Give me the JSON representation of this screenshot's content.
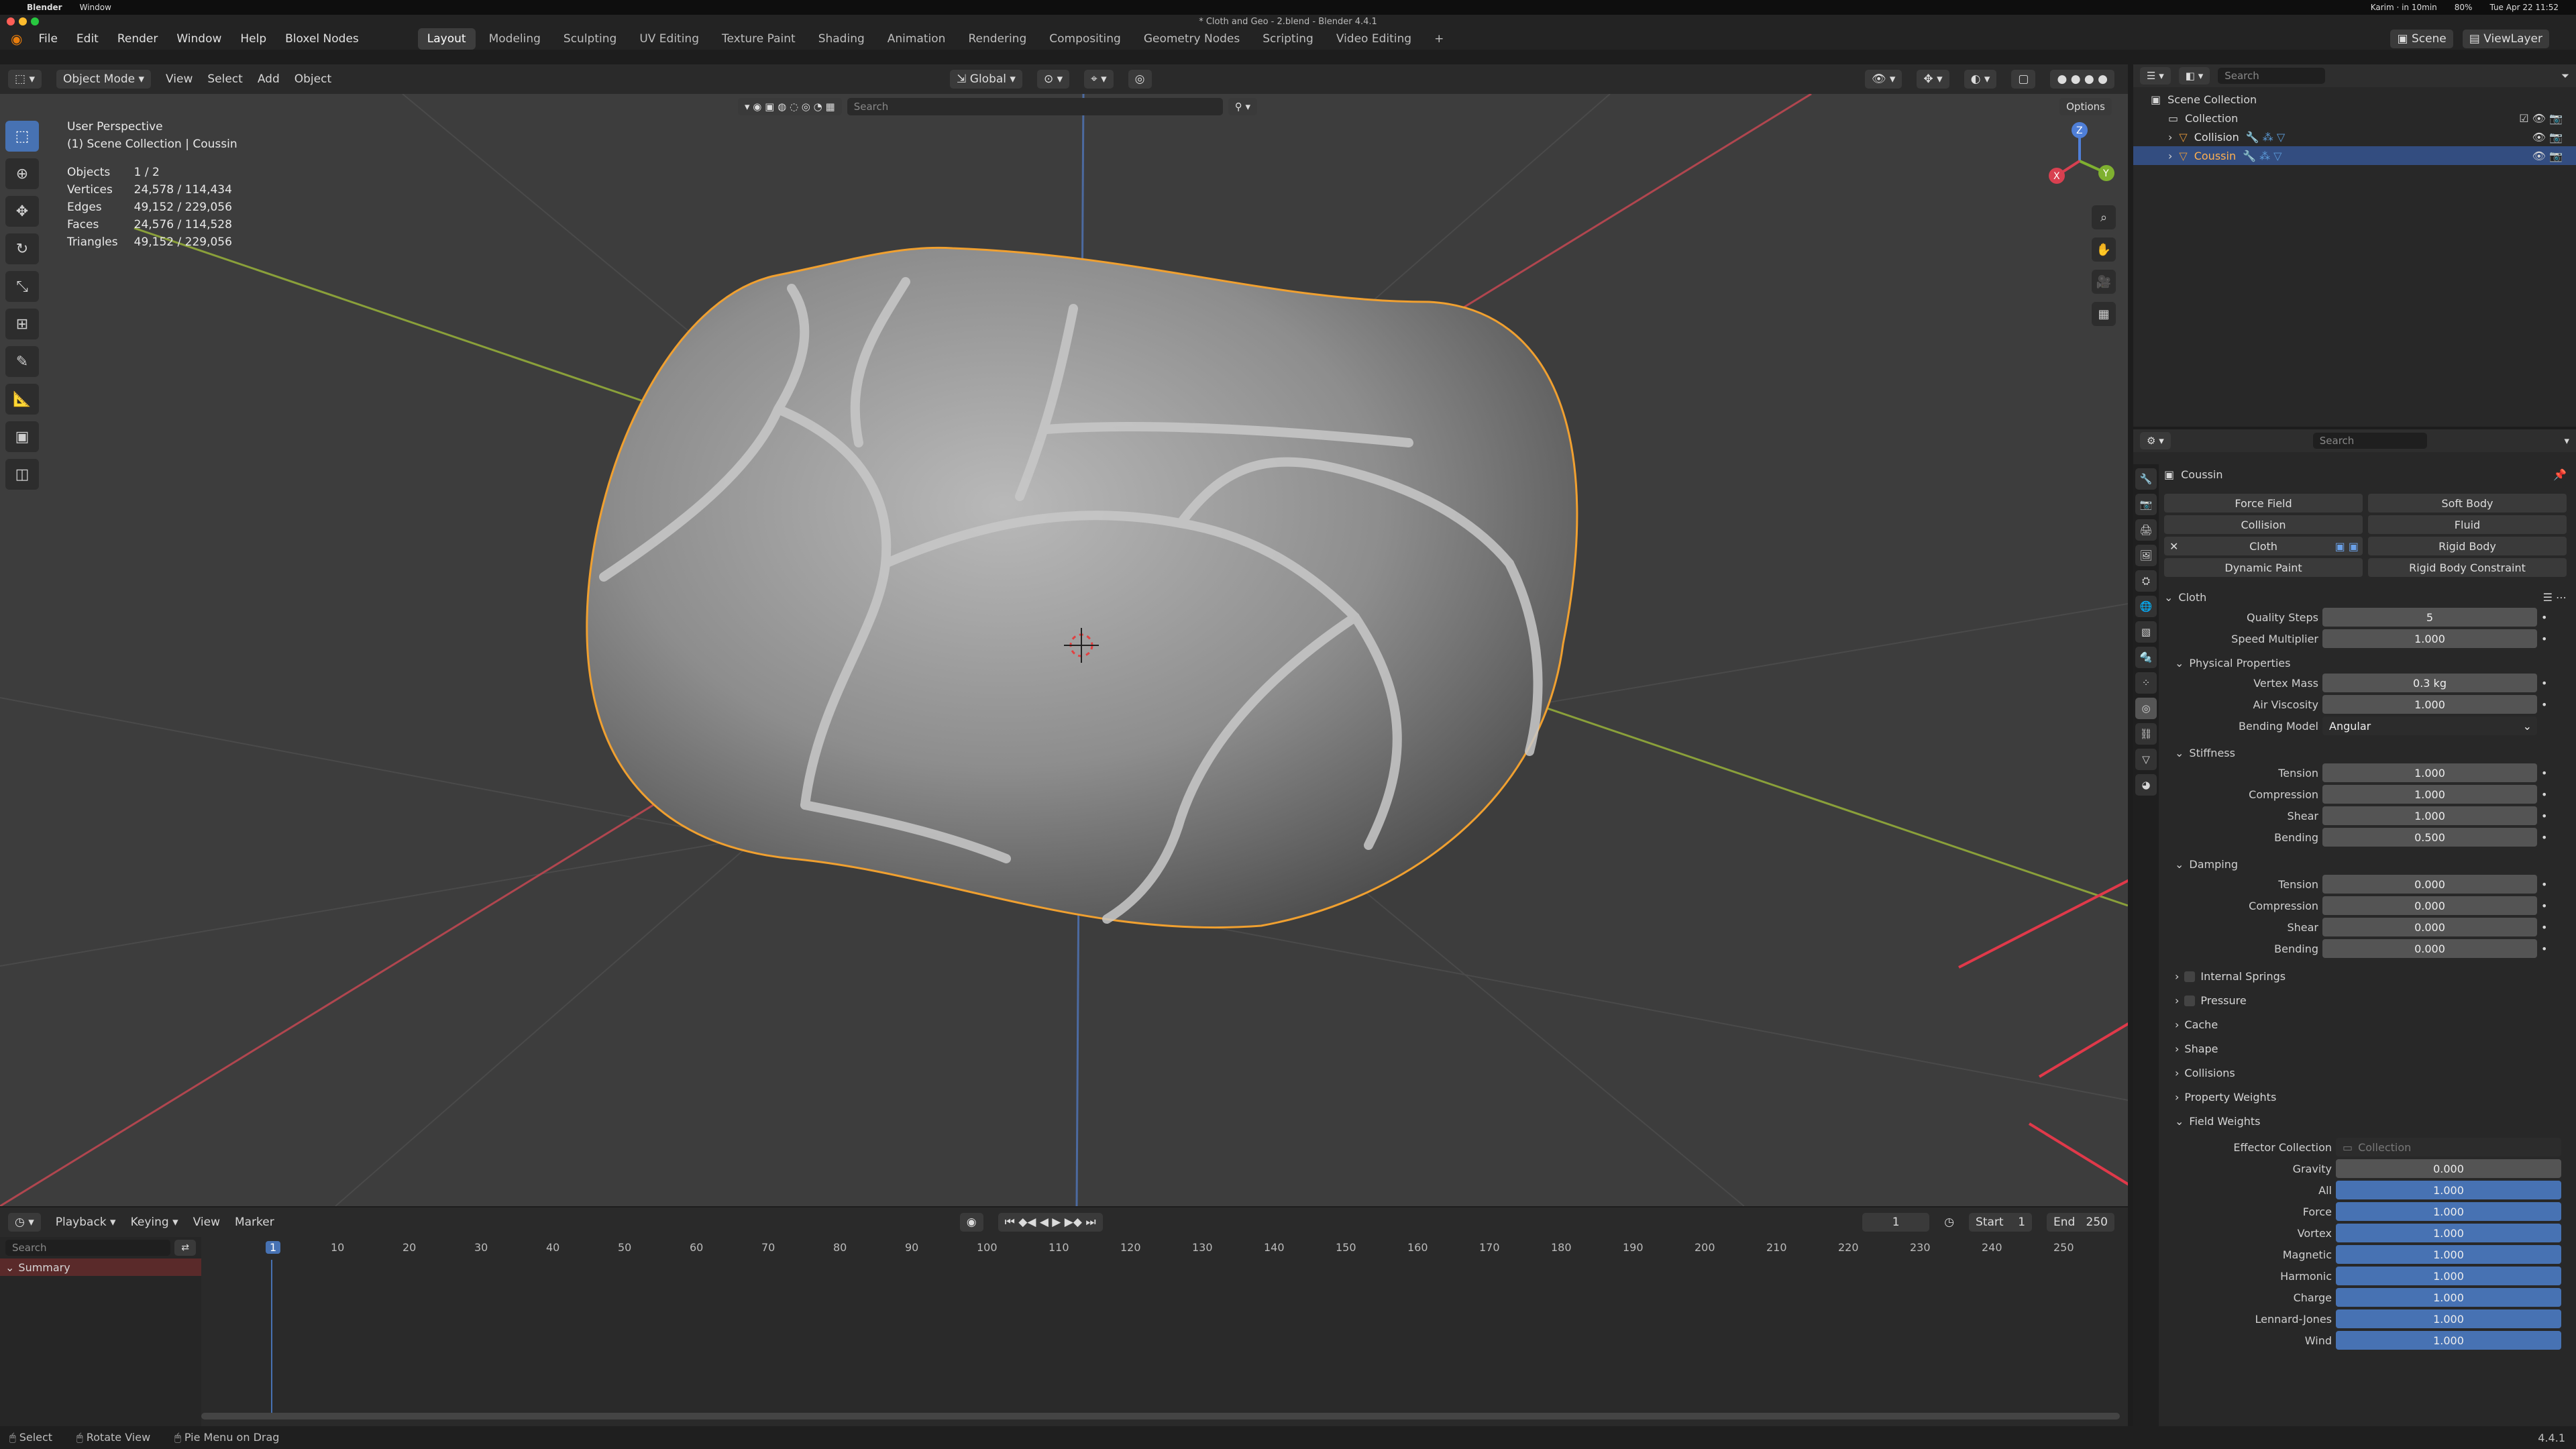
{
  "mac": {
    "apple": "",
    "app": "Blender",
    "window_menu": "Window",
    "meeting": "Karim · in 10min",
    "clock": "Tue Apr 22  11:52",
    "battery": "80%"
  },
  "titlebar": {
    "title": "* Cloth and Geo - 2.blend - Blender 4.4.1"
  },
  "menus": [
    "File",
    "Edit",
    "Render",
    "Window",
    "Help",
    "Bloxel Nodes"
  ],
  "workspaces": [
    "Layout",
    "Modeling",
    "Sculpting",
    "UV Editing",
    "Texture Paint",
    "Shading",
    "Animation",
    "Rendering",
    "Compositing",
    "Geometry Nodes",
    "Scripting",
    "Video Editing"
  ],
  "active_workspace": "Layout",
  "scene": {
    "label": "Scene",
    "viewlayer": "ViewLayer"
  },
  "viewport_header": {
    "mode": "Object Mode",
    "menus": [
      "View",
      "Select",
      "Add",
      "Object"
    ],
    "orientation": "Global",
    "search_placeholder": "Search",
    "options": "Options"
  },
  "viewport_info": {
    "perspective": "User Perspective",
    "collection": "(1) Scene Collection | Coussin",
    "stats": [
      {
        "label": "Objects",
        "value": "1 / 2"
      },
      {
        "label": "Vertices",
        "value": "24,578 / 114,434"
      },
      {
        "label": "Edges",
        "value": "49,152 / 229,056"
      },
      {
        "label": "Faces",
        "value": "24,576 / 114,528"
      },
      {
        "label": "Triangles",
        "value": "49,152 / 229,056"
      }
    ]
  },
  "gizmo_axes": {
    "x": "X",
    "y": "Y",
    "z": "Z"
  },
  "outliner": {
    "search_placeholder": "Search",
    "root": "Scene Collection",
    "collection": "Collection",
    "items": [
      "Collision",
      "Coussin"
    ],
    "selected": "Coussin"
  },
  "properties": {
    "search_placeholder": "Search",
    "object_name": "Coussin",
    "physics_buttons": [
      [
        "Force Field",
        "Soft Body"
      ],
      [
        "Collision",
        "Fluid"
      ],
      [
        "Cloth",
        "Rigid Body"
      ],
      [
        "Dynamic Paint",
        "Rigid Body Constraint"
      ]
    ],
    "cloth_header": "Cloth",
    "quality_steps": {
      "label": "Quality Steps",
      "value": "5"
    },
    "speed_multiplier": {
      "label": "Speed Multiplier",
      "value": "1.000"
    },
    "physical_header": "Physical Properties",
    "vertex_mass": {
      "label": "Vertex Mass",
      "value": "0.3 kg"
    },
    "air_viscosity": {
      "label": "Air Viscosity",
      "value": "1.000"
    },
    "bending_model": {
      "label": "Bending Model",
      "value": "Angular"
    },
    "stiffness_header": "Stiffness",
    "stiffness": [
      {
        "label": "Tension",
        "value": "1.000"
      },
      {
        "label": "Compression",
        "value": "1.000"
      },
      {
        "label": "Shear",
        "value": "1.000"
      },
      {
        "label": "Bending",
        "value": "0.500"
      }
    ],
    "damping_header": "Damping",
    "damping": [
      {
        "label": "Tension",
        "value": "0.000"
      },
      {
        "label": "Compression",
        "value": "0.000"
      },
      {
        "label": "Shear",
        "value": "0.000"
      },
      {
        "label": "Bending",
        "value": "0.000"
      }
    ],
    "collapsed_checks": [
      "Internal Springs",
      "Pressure"
    ],
    "collapsed": [
      "Cache",
      "Shape",
      "Collisions",
      "Property Weights"
    ],
    "field_weights_header": "Field Weights",
    "effector_collection": {
      "label": "Effector Collection",
      "placeholder": "Collection"
    },
    "gravity": {
      "label": "Gravity",
      "value": "0.000"
    },
    "weights": [
      {
        "label": "All",
        "value": "1.000"
      },
      {
        "label": "Force",
        "value": "1.000"
      },
      {
        "label": "Vortex",
        "value": "1.000"
      },
      {
        "label": "Magnetic",
        "value": "1.000"
      },
      {
        "label": "Harmonic",
        "value": "1.000"
      },
      {
        "label": "Charge",
        "value": "1.000"
      },
      {
        "label": "Lennard-Jones",
        "value": "1.000"
      },
      {
        "label": "Wind",
        "value": "1.000"
      }
    ]
  },
  "timeline": {
    "menus": [
      "Playback",
      "Keying",
      "View",
      "Marker"
    ],
    "current_frame": "1",
    "start_label": "Start",
    "start": "1",
    "end_label": "End",
    "end": "250",
    "search_placeholder": "Search",
    "summary": "Summary",
    "ticks": [
      "1",
      "10",
      "20",
      "30",
      "40",
      "50",
      "60",
      "70",
      "80",
      "90",
      "100",
      "110",
      "120",
      "130",
      "140",
      "150",
      "160",
      "170",
      "180",
      "190",
      "200",
      "210",
      "220",
      "230",
      "240",
      "250"
    ]
  },
  "statusbar": {
    "select": "Select",
    "rotate": "Rotate View",
    "pie": "Pie Menu on Drag",
    "version": "4.4.1"
  },
  "colors": {
    "accent": "#4772b3",
    "selection_outline": "#f0a030",
    "annotation": "#e0394a"
  }
}
